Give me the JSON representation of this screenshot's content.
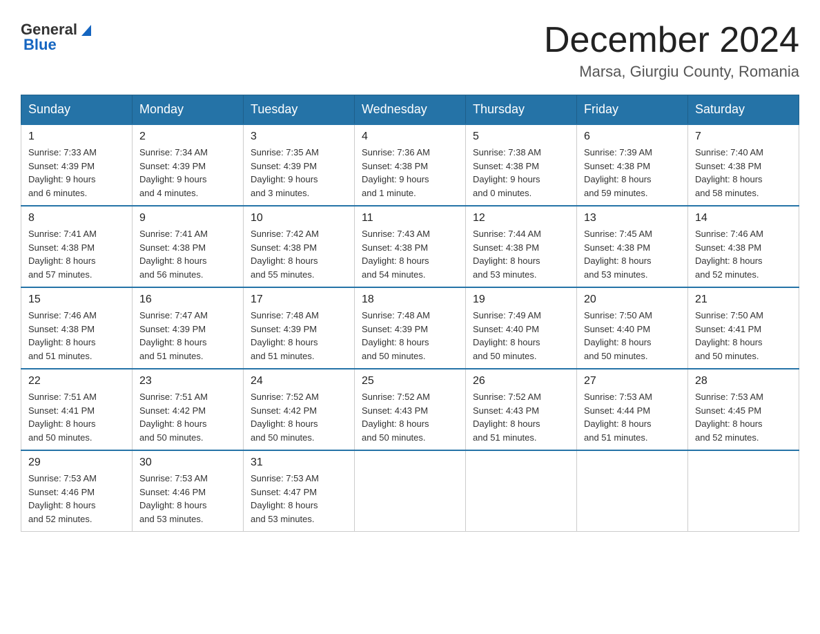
{
  "header": {
    "logo_general": "General",
    "logo_blue": "Blue",
    "month_title": "December 2024",
    "location": "Marsa, Giurgiu County, Romania"
  },
  "days_of_week": [
    "Sunday",
    "Monday",
    "Tuesday",
    "Wednesday",
    "Thursday",
    "Friday",
    "Saturday"
  ],
  "weeks": [
    [
      {
        "date": "1",
        "sunrise": "7:33 AM",
        "sunset": "4:39 PM",
        "daylight": "9 hours and 6 minutes."
      },
      {
        "date": "2",
        "sunrise": "7:34 AM",
        "sunset": "4:39 PM",
        "daylight": "9 hours and 4 minutes."
      },
      {
        "date": "3",
        "sunrise": "7:35 AM",
        "sunset": "4:39 PM",
        "daylight": "9 hours and 3 minutes."
      },
      {
        "date": "4",
        "sunrise": "7:36 AM",
        "sunset": "4:38 PM",
        "daylight": "9 hours and 1 minute."
      },
      {
        "date": "5",
        "sunrise": "7:38 AM",
        "sunset": "4:38 PM",
        "daylight": "9 hours and 0 minutes."
      },
      {
        "date": "6",
        "sunrise": "7:39 AM",
        "sunset": "4:38 PM",
        "daylight": "8 hours and 59 minutes."
      },
      {
        "date": "7",
        "sunrise": "7:40 AM",
        "sunset": "4:38 PM",
        "daylight": "8 hours and 58 minutes."
      }
    ],
    [
      {
        "date": "8",
        "sunrise": "7:41 AM",
        "sunset": "4:38 PM",
        "daylight": "8 hours and 57 minutes."
      },
      {
        "date": "9",
        "sunrise": "7:41 AM",
        "sunset": "4:38 PM",
        "daylight": "8 hours and 56 minutes."
      },
      {
        "date": "10",
        "sunrise": "7:42 AM",
        "sunset": "4:38 PM",
        "daylight": "8 hours and 55 minutes."
      },
      {
        "date": "11",
        "sunrise": "7:43 AM",
        "sunset": "4:38 PM",
        "daylight": "8 hours and 54 minutes."
      },
      {
        "date": "12",
        "sunrise": "7:44 AM",
        "sunset": "4:38 PM",
        "daylight": "8 hours and 53 minutes."
      },
      {
        "date": "13",
        "sunrise": "7:45 AM",
        "sunset": "4:38 PM",
        "daylight": "8 hours and 53 minutes."
      },
      {
        "date": "14",
        "sunrise": "7:46 AM",
        "sunset": "4:38 PM",
        "daylight": "8 hours and 52 minutes."
      }
    ],
    [
      {
        "date": "15",
        "sunrise": "7:46 AM",
        "sunset": "4:38 PM",
        "daylight": "8 hours and 51 minutes."
      },
      {
        "date": "16",
        "sunrise": "7:47 AM",
        "sunset": "4:39 PM",
        "daylight": "8 hours and 51 minutes."
      },
      {
        "date": "17",
        "sunrise": "7:48 AM",
        "sunset": "4:39 PM",
        "daylight": "8 hours and 51 minutes."
      },
      {
        "date": "18",
        "sunrise": "7:48 AM",
        "sunset": "4:39 PM",
        "daylight": "8 hours and 50 minutes."
      },
      {
        "date": "19",
        "sunrise": "7:49 AM",
        "sunset": "4:40 PM",
        "daylight": "8 hours and 50 minutes."
      },
      {
        "date": "20",
        "sunrise": "7:50 AM",
        "sunset": "4:40 PM",
        "daylight": "8 hours and 50 minutes."
      },
      {
        "date": "21",
        "sunrise": "7:50 AM",
        "sunset": "4:41 PM",
        "daylight": "8 hours and 50 minutes."
      }
    ],
    [
      {
        "date": "22",
        "sunrise": "7:51 AM",
        "sunset": "4:41 PM",
        "daylight": "8 hours and 50 minutes."
      },
      {
        "date": "23",
        "sunrise": "7:51 AM",
        "sunset": "4:42 PM",
        "daylight": "8 hours and 50 minutes."
      },
      {
        "date": "24",
        "sunrise": "7:52 AM",
        "sunset": "4:42 PM",
        "daylight": "8 hours and 50 minutes."
      },
      {
        "date": "25",
        "sunrise": "7:52 AM",
        "sunset": "4:43 PM",
        "daylight": "8 hours and 50 minutes."
      },
      {
        "date": "26",
        "sunrise": "7:52 AM",
        "sunset": "4:43 PM",
        "daylight": "8 hours and 51 minutes."
      },
      {
        "date": "27",
        "sunrise": "7:53 AM",
        "sunset": "4:44 PM",
        "daylight": "8 hours and 51 minutes."
      },
      {
        "date": "28",
        "sunrise": "7:53 AM",
        "sunset": "4:45 PM",
        "daylight": "8 hours and 52 minutes."
      }
    ],
    [
      {
        "date": "29",
        "sunrise": "7:53 AM",
        "sunset": "4:46 PM",
        "daylight": "8 hours and 52 minutes."
      },
      {
        "date": "30",
        "sunrise": "7:53 AM",
        "sunset": "4:46 PM",
        "daylight": "8 hours and 53 minutes."
      },
      {
        "date": "31",
        "sunrise": "7:53 AM",
        "sunset": "4:47 PM",
        "daylight": "8 hours and 53 minutes."
      },
      null,
      null,
      null,
      null
    ]
  ],
  "labels": {
    "sunrise": "Sunrise:",
    "sunset": "Sunset:",
    "daylight": "Daylight:"
  }
}
